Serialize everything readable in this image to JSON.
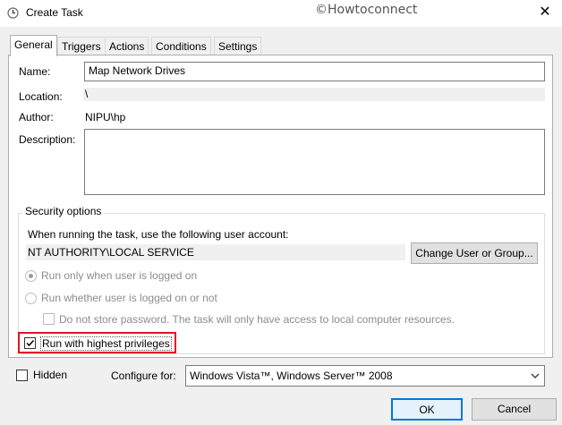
{
  "window": {
    "title": "Create Task",
    "watermark": "©Howtoconnect",
    "close_glyph": "✕"
  },
  "tabs": [
    {
      "label": "General"
    },
    {
      "label": "Triggers"
    },
    {
      "label": "Actions"
    },
    {
      "label": "Conditions"
    },
    {
      "label": "Settings"
    }
  ],
  "general": {
    "name_label": "Name:",
    "name_value": "Map Network Drives",
    "location_label": "Location:",
    "location_value": "\\",
    "author_label": "Author:",
    "author_value": "NIPU\\hp",
    "description_label": "Description:",
    "description_value": ""
  },
  "security": {
    "group_title": "Security options",
    "account_prompt": "When running the task, use the following user account:",
    "account_value": "NT AUTHORITY\\LOCAL SERVICE",
    "change_button": "Change User or Group...",
    "radio_logged_on": "Run only when user is logged on",
    "radio_whether": "Run whether user is logged on or not",
    "no_store_password": "Do not store password.  The task will only have access to local computer resources.",
    "highest_privileges": "Run with highest privileges",
    "highlight_color": "#e81123"
  },
  "bottom": {
    "hidden_label": "Hidden",
    "configure_label": "Configure for:",
    "configure_value": "Windows Vista™, Windows Server™ 2008",
    "ok_button": "OK",
    "cancel_button": "Cancel"
  },
  "icons": {
    "title_icon": "clock-icon",
    "dropdown_icon": "chevron-down-icon",
    "checkmark_icon": "checkmark-icon"
  }
}
